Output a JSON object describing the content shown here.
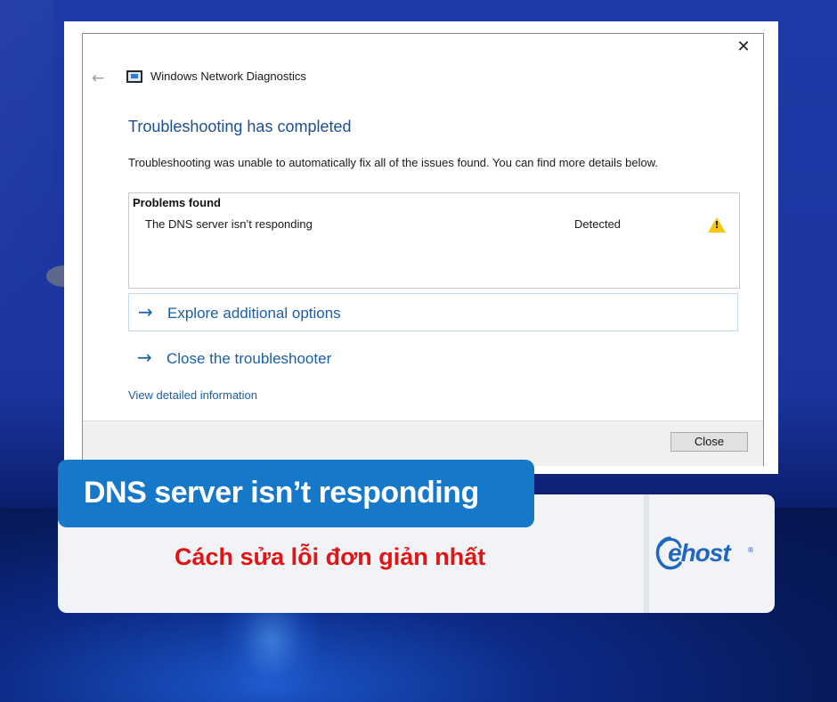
{
  "dialog": {
    "app_title": "Windows Network Diagnostics",
    "close_glyph": "✕",
    "back_glyph": "←",
    "heading": "Troubleshooting has completed",
    "description": "Troubleshooting was unable to automatically fix all of the issues found. You can find more details below.",
    "problems": {
      "header": "Problems found",
      "items": [
        {
          "name": "The DNS server isn’t responding",
          "status": "Detected",
          "icon": "warning-icon"
        }
      ]
    },
    "options": [
      {
        "arrow": "→",
        "label": "Explore additional options"
      },
      {
        "arrow": "→",
        "label": "Close the troubleshooter"
      }
    ],
    "view_details_link": "View detailed information",
    "close_button": "Close"
  },
  "banner": {
    "title": "DNS server isn’t responding",
    "subtitle": "Cách sửa lỗi đơn giản nhất",
    "logo": "ehost",
    "logo_mark": "®"
  },
  "colors": {
    "link_blue": "#1a5fa8",
    "heading_blue": "#1d4f91",
    "banner_blue": "#1578c9",
    "subtitle_red": "#e01414",
    "warning_yellow": "#f5c518",
    "background_blue": "#1d3aa6"
  }
}
